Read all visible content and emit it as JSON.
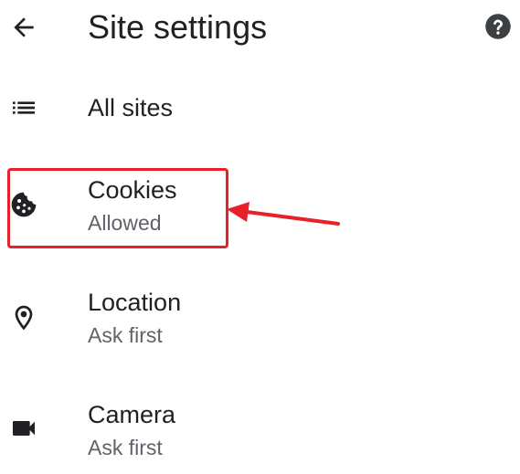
{
  "header": {
    "back_icon": "arrow-back-icon",
    "title": "Site settings",
    "help_icon": "help-circle-icon"
  },
  "list": [
    {
      "icon": "list-icon",
      "title": "All sites"
    },
    {
      "icon": "cookie-icon",
      "title": "Cookies",
      "subtitle": "Allowed"
    },
    {
      "icon": "location-pin-icon",
      "title": "Location",
      "subtitle": "Ask first"
    },
    {
      "icon": "videocam-icon",
      "title": "Camera",
      "subtitle": "Ask first"
    }
  ],
  "annotation": {
    "color": "#e8202a",
    "highlighted_item": "Cookies"
  }
}
